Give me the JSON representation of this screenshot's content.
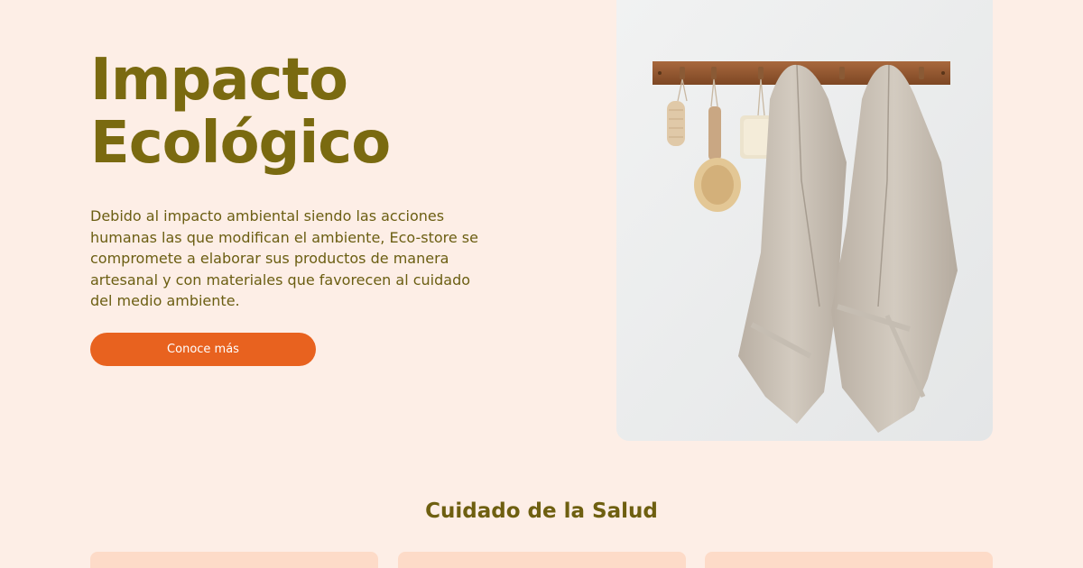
{
  "hero": {
    "title": "Impacto Ecológico",
    "description": "Debido al impacto ambiental siendo las acciones humanas las que modifican el ambiente, Eco-store se compromete a elaborar sus productos de manera artesanal y con materiales que favorecen al cuidado del medio ambiente.",
    "cta_label": "Conoce más"
  },
  "health_section": {
    "title": "Cuidado de la Salud"
  },
  "colors": {
    "background": "#fdeee6",
    "heading": "#7a6a10",
    "accent": "#e8621f",
    "card": "#fddbc8"
  }
}
